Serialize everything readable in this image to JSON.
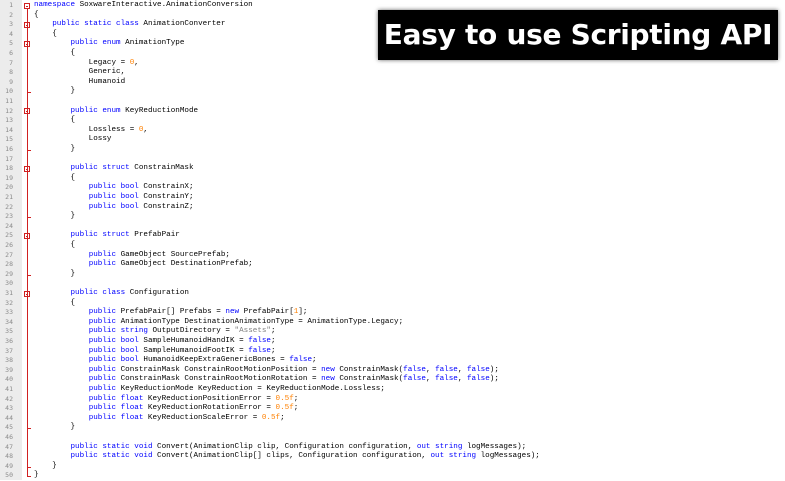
{
  "editor": {
    "lines": [
      {
        "n": "1",
        "t": [
          [
            "namespace",
            "kw"
          ],
          [
            " SoxwareInteractive.AnimationConversion",
            ""
          ]
        ]
      },
      {
        "n": "2",
        "t": [
          [
            "{",
            ""
          ]
        ]
      },
      {
        "n": "3",
        "t": [
          [
            "    ",
            ""
          ],
          [
            "public static class",
            "kw"
          ],
          [
            " AnimationConverter",
            ""
          ]
        ]
      },
      {
        "n": "4",
        "t": [
          [
            "    {",
            ""
          ]
        ]
      },
      {
        "n": "5",
        "t": [
          [
            "        ",
            ""
          ],
          [
            "public enum",
            "kw"
          ],
          [
            " AnimationType",
            ""
          ]
        ]
      },
      {
        "n": "6",
        "t": [
          [
            "        {",
            ""
          ]
        ]
      },
      {
        "n": "7",
        "t": [
          [
            "            Legacy = ",
            ""
          ],
          [
            "0",
            "num"
          ],
          [
            ",",
            ""
          ]
        ]
      },
      {
        "n": "8",
        "t": [
          [
            "            Generic,",
            ""
          ]
        ]
      },
      {
        "n": "9",
        "t": [
          [
            "            Humanoid",
            ""
          ]
        ]
      },
      {
        "n": "10",
        "t": [
          [
            "        }",
            ""
          ]
        ]
      },
      {
        "n": "11",
        "t": [
          [
            "",
            ""
          ]
        ]
      },
      {
        "n": "12",
        "t": [
          [
            "        ",
            ""
          ],
          [
            "public enum",
            "kw"
          ],
          [
            " KeyReductionMode",
            ""
          ]
        ]
      },
      {
        "n": "13",
        "t": [
          [
            "        {",
            ""
          ]
        ]
      },
      {
        "n": "14",
        "t": [
          [
            "            Lossless = ",
            ""
          ],
          [
            "0",
            "num"
          ],
          [
            ",",
            ""
          ]
        ]
      },
      {
        "n": "15",
        "t": [
          [
            "            Lossy",
            ""
          ]
        ]
      },
      {
        "n": "16",
        "t": [
          [
            "        }",
            ""
          ]
        ]
      },
      {
        "n": "17",
        "t": [
          [
            "",
            ""
          ]
        ]
      },
      {
        "n": "18",
        "t": [
          [
            "        ",
            ""
          ],
          [
            "public struct",
            "kw"
          ],
          [
            " ConstrainMask",
            ""
          ]
        ]
      },
      {
        "n": "19",
        "t": [
          [
            "        {",
            ""
          ]
        ]
      },
      {
        "n": "20",
        "t": [
          [
            "            ",
            ""
          ],
          [
            "public bool",
            "kw"
          ],
          [
            " ConstrainX;",
            ""
          ]
        ]
      },
      {
        "n": "21",
        "t": [
          [
            "            ",
            ""
          ],
          [
            "public bool",
            "kw"
          ],
          [
            " ConstrainY;",
            ""
          ]
        ]
      },
      {
        "n": "22",
        "t": [
          [
            "            ",
            ""
          ],
          [
            "public bool",
            "kw"
          ],
          [
            " ConstrainZ;",
            ""
          ]
        ]
      },
      {
        "n": "23",
        "t": [
          [
            "        }",
            ""
          ]
        ]
      },
      {
        "n": "24",
        "t": [
          [
            "",
            ""
          ]
        ]
      },
      {
        "n": "25",
        "t": [
          [
            "        ",
            ""
          ],
          [
            "public struct",
            "kw"
          ],
          [
            " PrefabPair",
            ""
          ]
        ]
      },
      {
        "n": "26",
        "t": [
          [
            "        {",
            ""
          ]
        ]
      },
      {
        "n": "27",
        "t": [
          [
            "            ",
            ""
          ],
          [
            "public",
            "kw"
          ],
          [
            " GameObject SourcePrefab;",
            ""
          ]
        ]
      },
      {
        "n": "28",
        "t": [
          [
            "            ",
            ""
          ],
          [
            "public",
            "kw"
          ],
          [
            " GameObject DestinationPrefab;",
            ""
          ]
        ]
      },
      {
        "n": "29",
        "t": [
          [
            "        }",
            ""
          ]
        ]
      },
      {
        "n": "30",
        "t": [
          [
            "",
            ""
          ]
        ]
      },
      {
        "n": "31",
        "t": [
          [
            "        ",
            ""
          ],
          [
            "public class",
            "kw"
          ],
          [
            " Configuration",
            ""
          ]
        ]
      },
      {
        "n": "32",
        "t": [
          [
            "        {",
            ""
          ]
        ]
      },
      {
        "n": "33",
        "t": [
          [
            "            ",
            ""
          ],
          [
            "public",
            "kw"
          ],
          [
            " PrefabPair[] Prefabs = ",
            ""
          ],
          [
            "new",
            "kw"
          ],
          [
            " PrefabPair[",
            ""
          ],
          [
            "1",
            "num"
          ],
          [
            "];",
            ""
          ]
        ]
      },
      {
        "n": "34",
        "t": [
          [
            "            ",
            ""
          ],
          [
            "public",
            "kw"
          ],
          [
            " AnimationType DestinationAnimationType = AnimationType.Legacy;",
            ""
          ]
        ]
      },
      {
        "n": "35",
        "t": [
          [
            "            ",
            ""
          ],
          [
            "public string",
            "kw"
          ],
          [
            " OutputDirectory = ",
            ""
          ],
          [
            "\"Assets\"",
            "str"
          ],
          [
            ";",
            ""
          ]
        ]
      },
      {
        "n": "36",
        "t": [
          [
            "            ",
            ""
          ],
          [
            "public bool",
            "kw"
          ],
          [
            " SampleHumanoidHandIK = ",
            ""
          ],
          [
            "false",
            "kw"
          ],
          [
            ";",
            ""
          ]
        ]
      },
      {
        "n": "37",
        "t": [
          [
            "            ",
            ""
          ],
          [
            "public bool",
            "kw"
          ],
          [
            " SampleHumanoidFootIK = ",
            ""
          ],
          [
            "false",
            "kw"
          ],
          [
            ";",
            ""
          ]
        ]
      },
      {
        "n": "38",
        "t": [
          [
            "            ",
            ""
          ],
          [
            "public bool",
            "kw"
          ],
          [
            " HumanoidKeepExtraGenericBones = ",
            ""
          ],
          [
            "false",
            "kw"
          ],
          [
            ";",
            ""
          ]
        ]
      },
      {
        "n": "39",
        "t": [
          [
            "            ",
            ""
          ],
          [
            "public",
            "kw"
          ],
          [
            " ConstrainMask ConstrainRootMotionPosition = ",
            ""
          ],
          [
            "new",
            "kw"
          ],
          [
            " ConstrainMask(",
            ""
          ],
          [
            "false",
            "kw"
          ],
          [
            ", ",
            ""
          ],
          [
            "false",
            "kw"
          ],
          [
            ", ",
            ""
          ],
          [
            "false",
            "kw"
          ],
          [
            ");",
            ""
          ]
        ]
      },
      {
        "n": "40",
        "t": [
          [
            "            ",
            ""
          ],
          [
            "public",
            "kw"
          ],
          [
            " ConstrainMask ConstrainRootMotionRotation = ",
            ""
          ],
          [
            "new",
            "kw"
          ],
          [
            " ConstrainMask(",
            ""
          ],
          [
            "false",
            "kw"
          ],
          [
            ", ",
            ""
          ],
          [
            "false",
            "kw"
          ],
          [
            ", ",
            ""
          ],
          [
            "false",
            "kw"
          ],
          [
            ");",
            ""
          ]
        ]
      },
      {
        "n": "41",
        "t": [
          [
            "            ",
            ""
          ],
          [
            "public",
            "kw"
          ],
          [
            " KeyReductionMode KeyReduction = KeyReductionMode.Lossless;",
            ""
          ]
        ]
      },
      {
        "n": "42",
        "t": [
          [
            "            ",
            ""
          ],
          [
            "public float",
            "kw"
          ],
          [
            " KeyReductionPositionError = ",
            ""
          ],
          [
            "0.5f",
            "num"
          ],
          [
            ";",
            ""
          ]
        ]
      },
      {
        "n": "43",
        "t": [
          [
            "            ",
            ""
          ],
          [
            "public float",
            "kw"
          ],
          [
            " KeyReductionRotationError = ",
            ""
          ],
          [
            "0.5f",
            "num"
          ],
          [
            ";",
            ""
          ]
        ]
      },
      {
        "n": "44",
        "t": [
          [
            "            ",
            ""
          ],
          [
            "public float",
            "kw"
          ],
          [
            " KeyReductionScaleError = ",
            ""
          ],
          [
            "0.5f",
            "num"
          ],
          [
            ";",
            ""
          ]
        ]
      },
      {
        "n": "45",
        "t": [
          [
            "        }",
            ""
          ]
        ]
      },
      {
        "n": "46",
        "t": [
          [
            "",
            ""
          ]
        ]
      },
      {
        "n": "47",
        "t": [
          [
            "        ",
            ""
          ],
          [
            "public static void",
            "kw"
          ],
          [
            " Convert(AnimationClip clip, Configuration configuration, ",
            ""
          ],
          [
            "out string",
            "kw"
          ],
          [
            " logMessages);",
            ""
          ]
        ]
      },
      {
        "n": "48",
        "t": [
          [
            "        ",
            ""
          ],
          [
            "public static void",
            "kw"
          ],
          [
            " Convert(AnimationClip[] clips, Configuration configuration, ",
            ""
          ],
          [
            "out string",
            "kw"
          ],
          [
            " logMessages);",
            ""
          ]
        ]
      },
      {
        "n": "49",
        "t": [
          [
            "    }",
            ""
          ]
        ]
      },
      {
        "n": "50",
        "t": [
          [
            "}",
            ""
          ]
        ]
      }
    ]
  },
  "banner": {
    "title": "Easy to use Scripting API"
  },
  "colors": {
    "keyword": "#0000ff",
    "number": "#ff8000",
    "string": "#808080",
    "fold_marker": "#d02020",
    "banner_bg": "#000000",
    "banner_text": "#ffffff"
  }
}
